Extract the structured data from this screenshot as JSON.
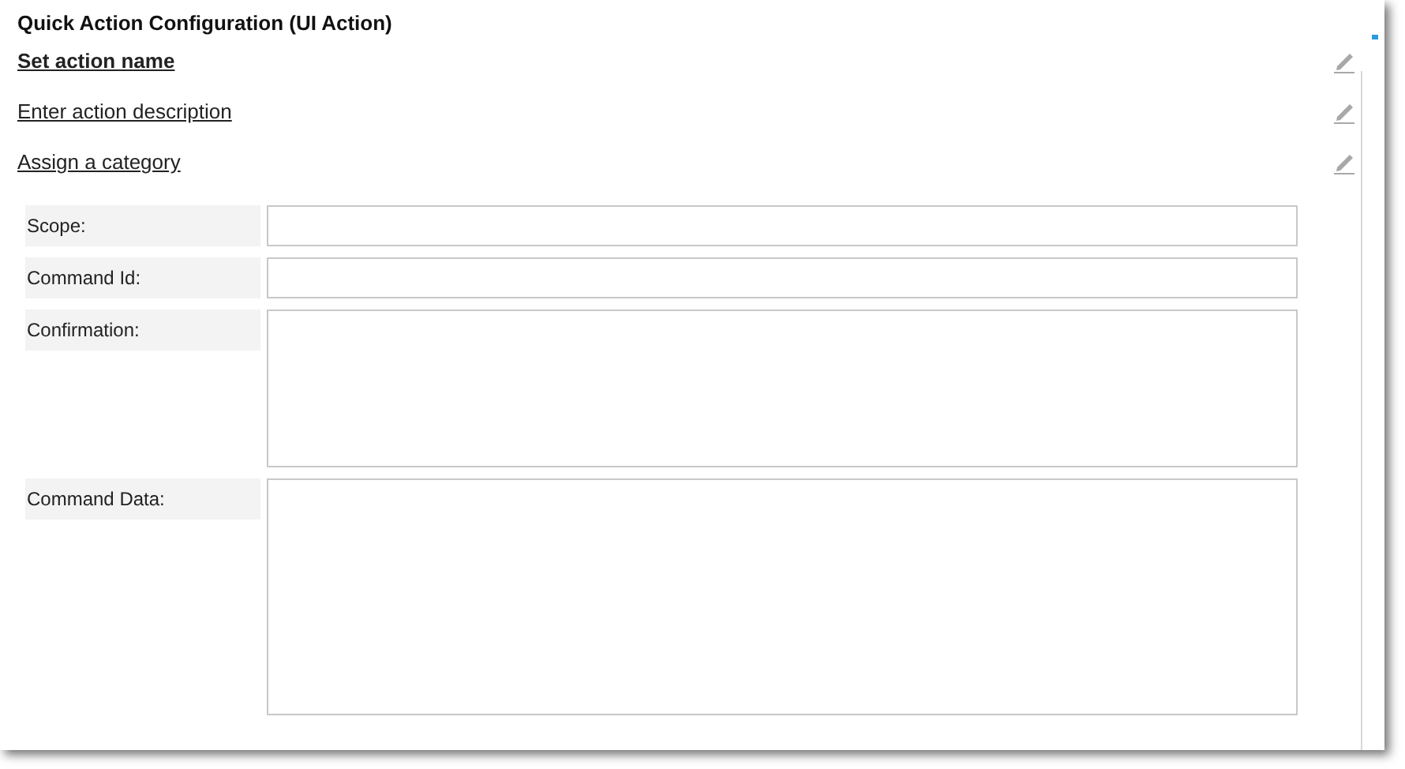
{
  "title": "Quick Action Configuration (UI Action)",
  "links": [
    {
      "label": "Set action name",
      "bold": true
    },
    {
      "label": "Enter action description",
      "bold": false
    },
    {
      "label": "Assign a category",
      "bold": false
    }
  ],
  "fields": [
    {
      "label": "Scope:",
      "kind": "input"
    },
    {
      "label": "Command Id:",
      "kind": "input"
    },
    {
      "label": "Confirmation:",
      "kind": "textarea"
    },
    {
      "label": "Command Data:",
      "kind": "editor"
    }
  ]
}
